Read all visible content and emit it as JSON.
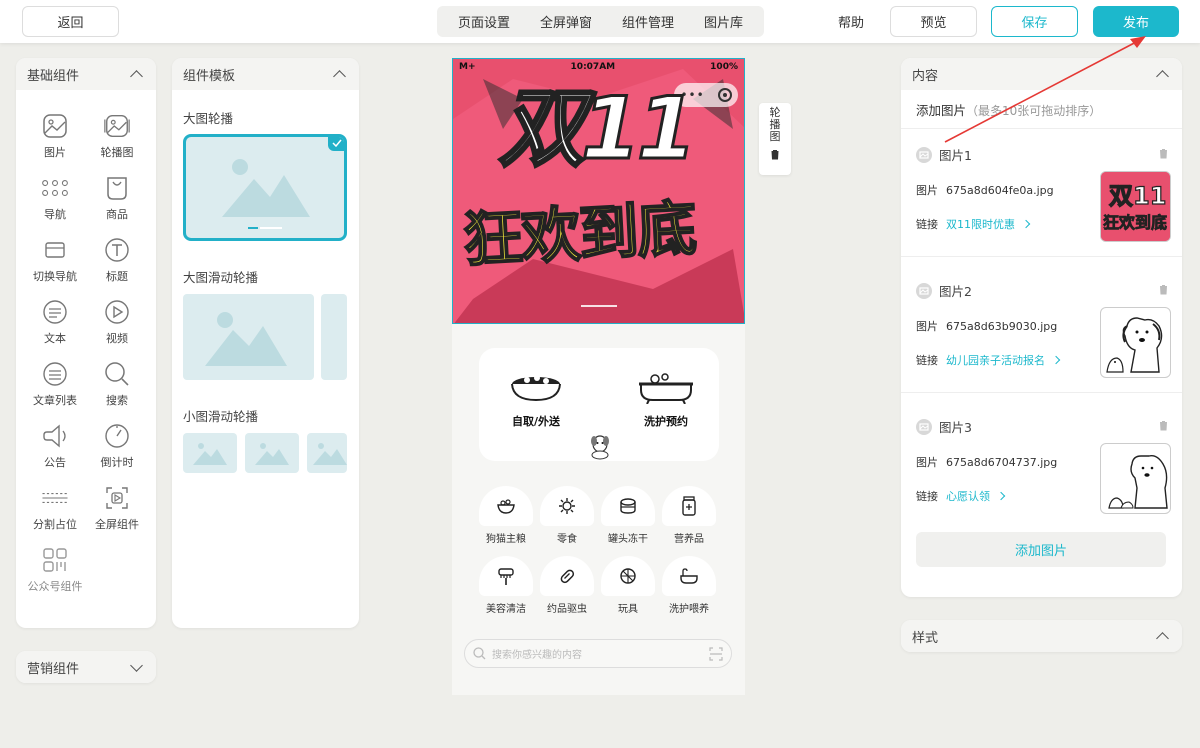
{
  "topbar": {
    "back_label": "返回",
    "tabs": [
      "页面设置",
      "全屏弹窗",
      "组件管理",
      "图片库"
    ],
    "help_label": "帮助",
    "preview_label": "预览",
    "save_label": "保存",
    "publish_label": "发布"
  },
  "basic_panel": {
    "title": "基础组件",
    "items": [
      {
        "label": "图片",
        "icon": "image-icon"
      },
      {
        "label": "轮播图",
        "icon": "carousel-icon"
      },
      {
        "label": "导航",
        "icon": "nav-dots-icon"
      },
      {
        "label": "商品",
        "icon": "bag-icon"
      },
      {
        "label": "切换导航",
        "icon": "tab-nav-icon"
      },
      {
        "label": "标题",
        "icon": "title-t-icon"
      },
      {
        "label": "文本",
        "icon": "text-icon"
      },
      {
        "label": "视频",
        "icon": "play-icon"
      },
      {
        "label": "文章列表",
        "icon": "article-list-icon"
      },
      {
        "label": "搜索",
        "icon": "search-icon"
      },
      {
        "label": "公告",
        "icon": "speaker-icon"
      },
      {
        "label": "倒计时",
        "icon": "clock-icon"
      },
      {
        "label": "分割占位",
        "icon": "divider-icon"
      },
      {
        "label": "全屏组件",
        "icon": "fullscreen-icon"
      },
      {
        "label": "公众号组件",
        "icon": "qr-grid-icon"
      }
    ]
  },
  "marketing_panel": {
    "title": "营销组件"
  },
  "template_panel": {
    "title": "组件模板",
    "sections": [
      "大图轮播",
      "大图滑动轮播",
      "小图滑动轮播"
    ]
  },
  "phone": {
    "status": {
      "left": "M+",
      "time": "10:07AM",
      "battery": "100%"
    },
    "banner_text_1": "双11",
    "banner_text_2": "狂欢到底",
    "services": [
      "自取/外送",
      "洗护预约"
    ],
    "categories": [
      "狗猫主粮",
      "零食",
      "罐头冻干",
      "营养品",
      "美容清洁",
      "约品驱虫",
      "玩具",
      "洗护喂养"
    ],
    "search_placeholder": "搜索你感兴趣的内容"
  },
  "side_tool": {
    "label_chars": [
      "轮",
      "播",
      "图"
    ]
  },
  "content_panel": {
    "title": "内容",
    "add_hint_label": "添加图片",
    "add_hint_note": "（最多10张可拖动排序）",
    "image_key": "图片",
    "link_key": "链接",
    "items": [
      {
        "title": "图片1",
        "file": "675a8d604fe0a.jpg",
        "link": "双11限时优惠"
      },
      {
        "title": "图片2",
        "file": "675a8d63b9030.jpg",
        "link": "幼儿园亲子活动报名"
      },
      {
        "title": "图片3",
        "file": "675a8d6704737.jpg",
        "link": "心愿认领"
      }
    ],
    "add_button_label": "添加图片"
  },
  "style_panel": {
    "title": "样式"
  },
  "colors": {
    "accent": "#1cb8cc",
    "banner_bg": "#e8506e",
    "arrow": "#e53935"
  }
}
